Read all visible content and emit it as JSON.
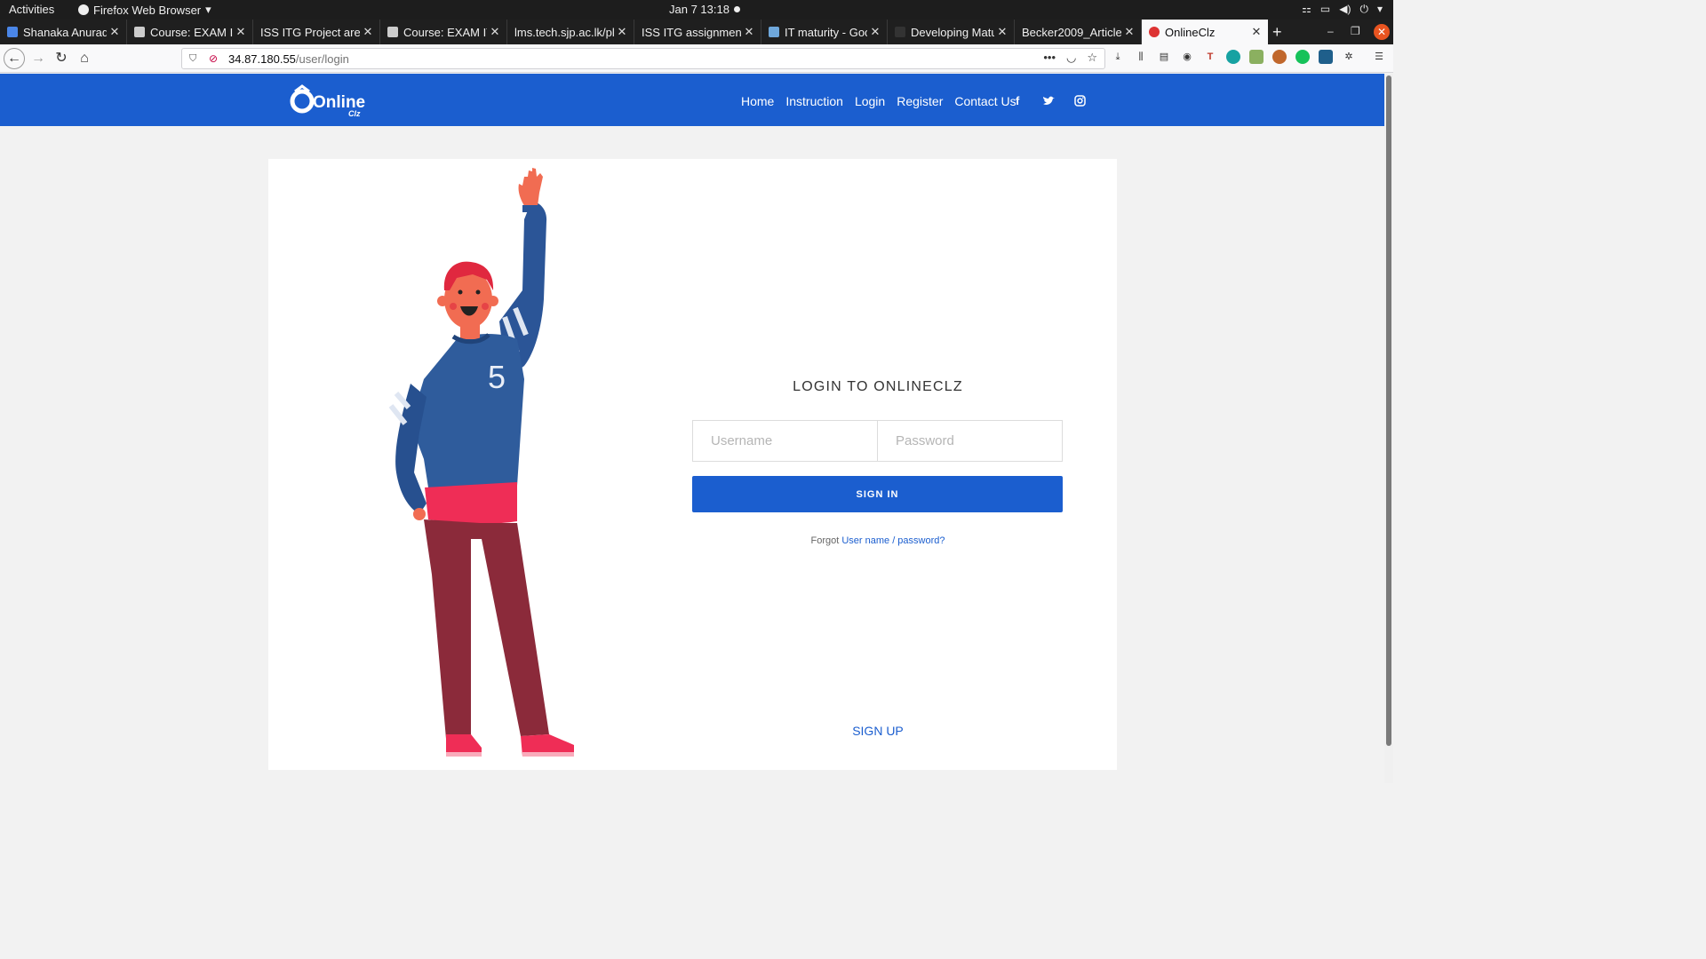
{
  "system_bar": {
    "activities": "Activities",
    "app_name": "Firefox Web Browser",
    "clock": "Jan 7  13:18"
  },
  "tabs": [
    {
      "title": "Shanaka Anuradh",
      "active": false
    },
    {
      "title": "Course: EXAM IT",
      "active": false
    },
    {
      "title": "ISS ITG Project area",
      "active": false
    },
    {
      "title": "Course: EXAM IT",
      "active": false
    },
    {
      "title": "lms.tech.sjp.ac.lk/pl",
      "active": false
    },
    {
      "title": "ISS ITG assignment.p",
      "active": false
    },
    {
      "title": "IT maturity - Goo",
      "active": false
    },
    {
      "title": "Developing Matu",
      "active": false
    },
    {
      "title": "Becker2009_Article",
      "active": false
    },
    {
      "title": "OnlineClz",
      "active": true
    }
  ],
  "url": {
    "host": "34.87.180.55",
    "path": "/user/login"
  },
  "site": {
    "logo_text": "Online",
    "logo_sub": "Clz",
    "nav": [
      "Home",
      "Instruction",
      "Login",
      "Register",
      "Contact Us"
    ],
    "social": [
      "f",
      "t",
      "ig"
    ],
    "brand_color": "#1b5ecf"
  },
  "login": {
    "title": "LOGIN TO ONLINECLZ",
    "username_placeholder": "Username",
    "password_placeholder": "Password",
    "signin_label": "SIGN IN",
    "forgot_prefix": "Forgot ",
    "forgot_link": "User name / password?",
    "signup_label": "SIGN UP"
  },
  "illustration": {
    "jersey_number": "5"
  }
}
